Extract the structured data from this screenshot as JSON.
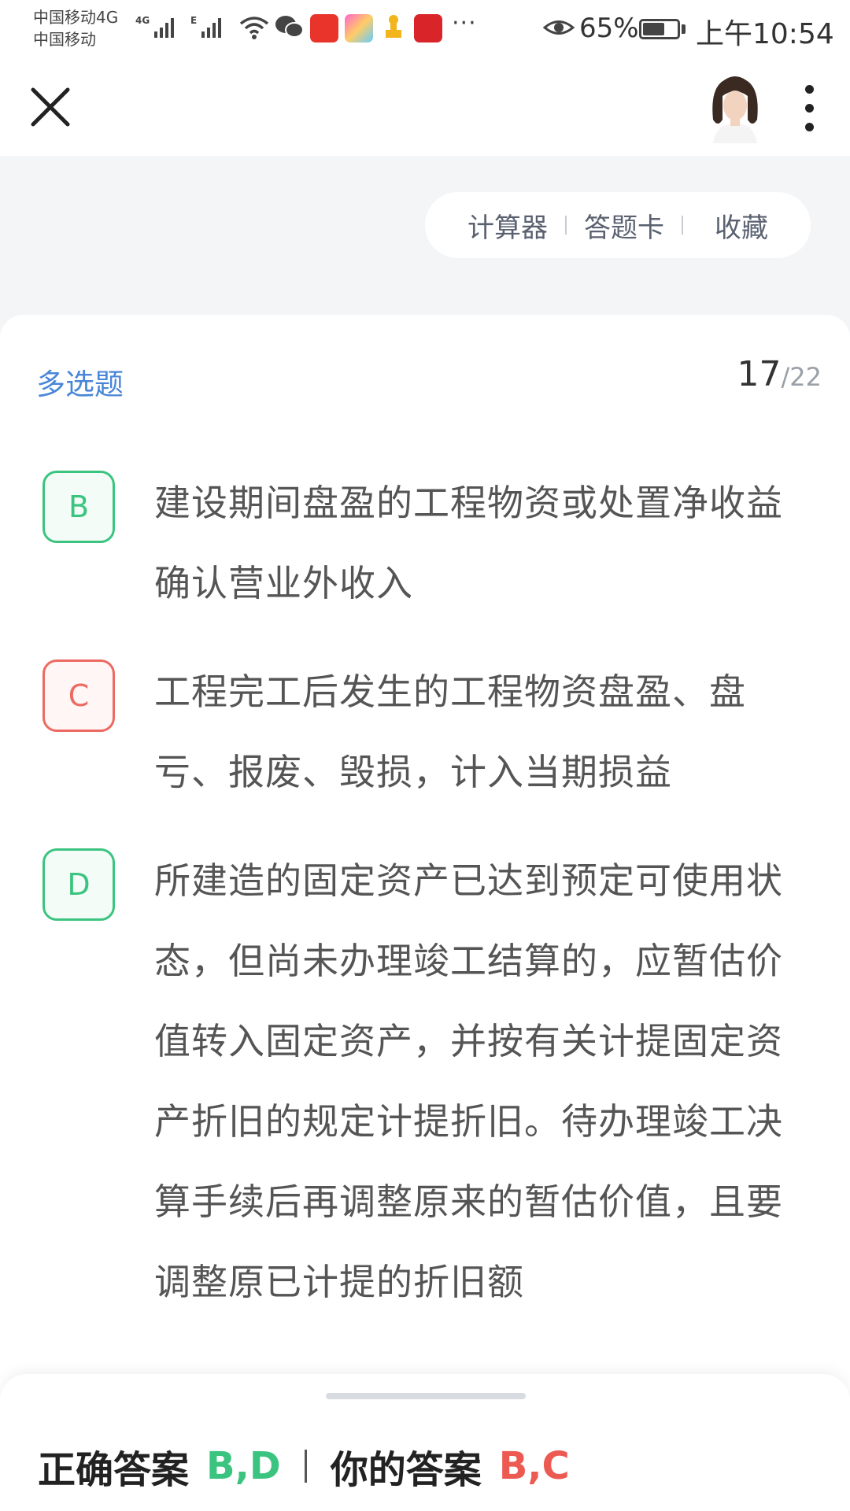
{
  "status_bar": {
    "carrier_1": "中国移动4G",
    "carrier_2": "中国移动",
    "net_1": "4G",
    "net_2": "E",
    "more": "···",
    "battery_percent": "65%",
    "battery_level": 0.65,
    "time": "上午10:54"
  },
  "toolbar": {
    "calculator": "计算器",
    "answer_card": "答题卡",
    "favorite": "收藏"
  },
  "question": {
    "type": "多选题",
    "current": "17",
    "total": "/22"
  },
  "options": [
    {
      "letter": "B",
      "state": "correct-selected",
      "text": "建设期间盘盈的工程物资或处置净收益确认营业外收入"
    },
    {
      "letter": "C",
      "state": "wrong-selected",
      "text": "工程完工后发生的工程物资盘盈、盘亏、报废、毁损，计入当期损益"
    },
    {
      "letter": "D",
      "state": "correct-missed",
      "text": "所建造的固定资产已达到预定可使用状态，但尚未办理竣工结算的，应暂估价值转入固定资产，并按有关计提固定资产折旧的规定计提折旧。待办理竣工决算手续后再调整原来的暂估价值，且要调整原已计提的折旧额"
    }
  ],
  "answer": {
    "correct_label": "正确答案",
    "correct_value": "B,D",
    "mine_label": "你的答案",
    "mine_value": "B,C"
  },
  "colors": {
    "correct": "#3bc47f",
    "wrong": "#ec6a62",
    "accent": "#4a86d8"
  }
}
